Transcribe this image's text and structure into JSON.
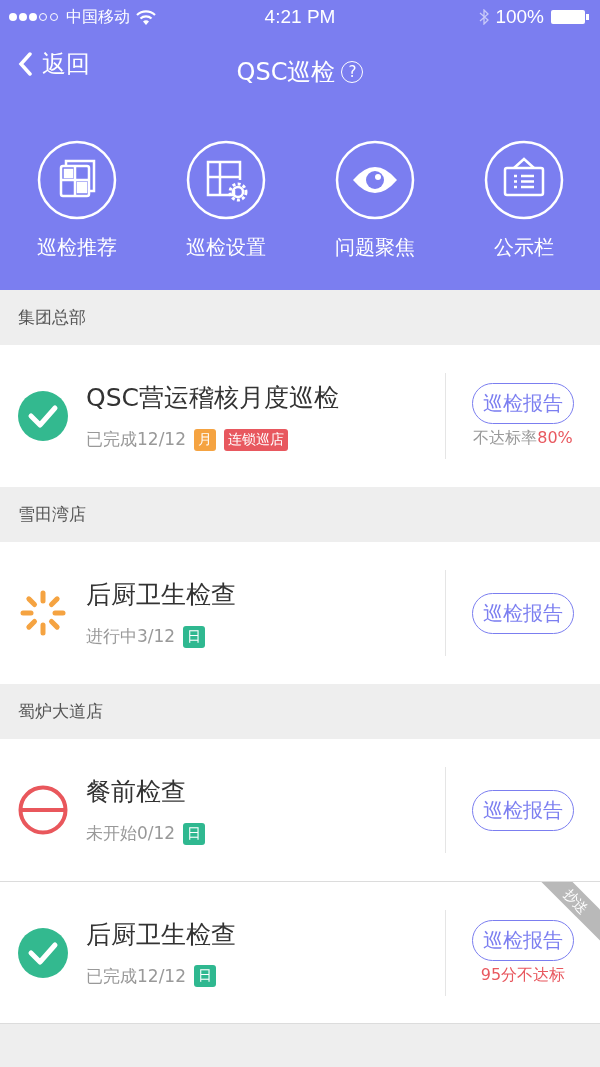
{
  "status_bar": {
    "carrier": "中国移动",
    "time": "4:21 PM",
    "battery": "100%"
  },
  "nav": {
    "back": "返回",
    "title": "QSC巡检",
    "help": "?"
  },
  "shortcuts": [
    {
      "label": "巡检推荐",
      "kind": "pages"
    },
    {
      "label": "巡检设置",
      "kind": "settings"
    },
    {
      "label": "问题聚焦",
      "kind": "eye"
    },
    {
      "label": "公示栏",
      "kind": "board"
    }
  ],
  "groups": [
    {
      "name": "集团总部",
      "tasks": [
        {
          "title": "QSC营运稽核月度巡检",
          "kind": "done",
          "progress": "已完成12/12",
          "tags": [
            {
              "label": "月",
              "color": "#f5a341"
            },
            {
              "label": "连锁巡店",
              "color": "#e8585f"
            }
          ],
          "button": "巡检报告",
          "note": {
            "kind": "rate",
            "label": "不达标率",
            "value": "80%"
          },
          "cc": false
        }
      ]
    },
    {
      "name": "雪田湾店",
      "tasks": [
        {
          "title": "后厨卫生检查",
          "kind": "in_progress",
          "progress": "进行中3/12",
          "tags": [
            {
              "label": "日",
              "color": "#2fb890"
            }
          ],
          "button": "巡检报告",
          "cc": false
        }
      ]
    },
    {
      "name": "蜀炉大道店",
      "tasks": [
        {
          "title": "餐前检查",
          "kind": "not_started",
          "progress": "未开始0/12",
          "tags": [
            {
              "label": "日",
              "color": "#2fb890"
            }
          ],
          "button": "巡检报告",
          "cc": false
        },
        {
          "title": "后厨卫生检查",
          "kind": "done",
          "progress": "已完成12/12",
          "tags": [
            {
              "label": "日",
              "color": "#2fb890"
            }
          ],
          "button": "巡检报告",
          "note": {
            "kind": "alert",
            "text": "95分不达标"
          },
          "cc": true,
          "cc_label": "抄送"
        }
      ]
    }
  ]
}
